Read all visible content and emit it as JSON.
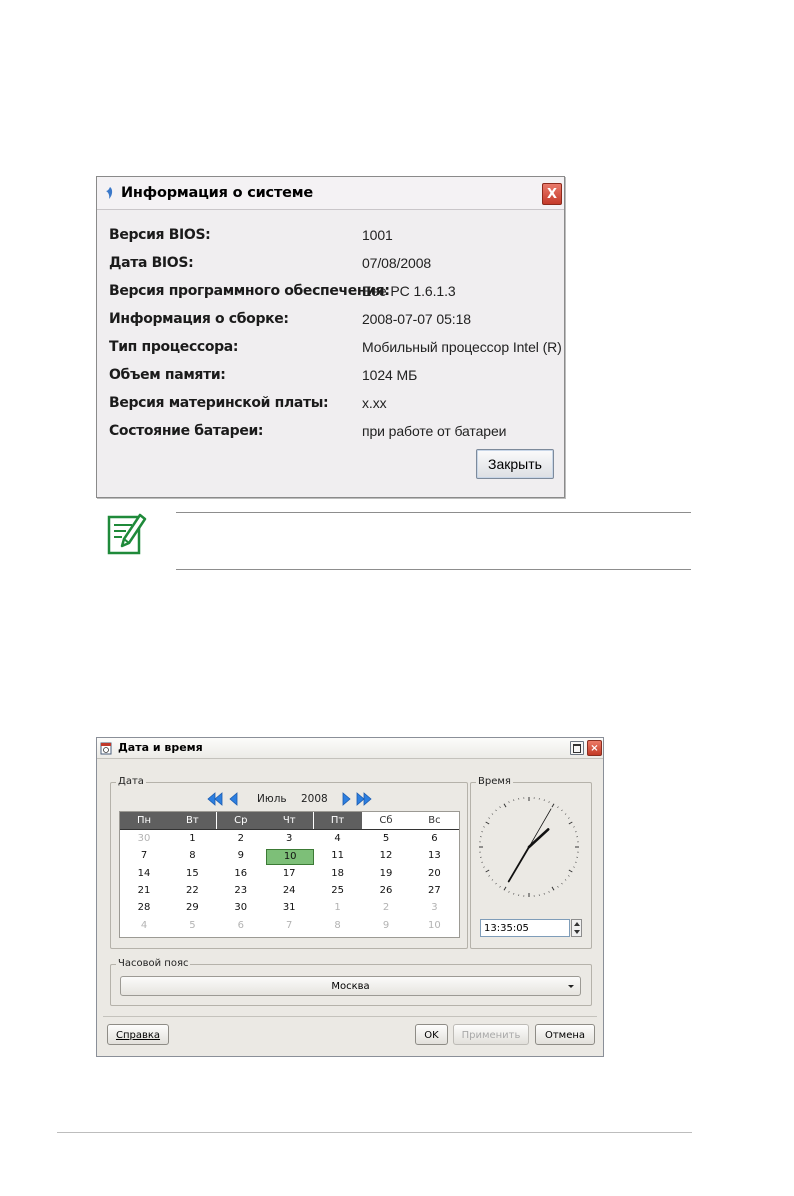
{
  "sysinfo": {
    "title": "Информация о системе",
    "close_glyph": "X",
    "rows": [
      {
        "label": "Версия BIOS:",
        "value": "1001"
      },
      {
        "label": "Дата BIOS:",
        "value": "07/08/2008"
      },
      {
        "label": "Версия программного обеспечения:",
        "value": "Eee PC 1.6.1.3"
      },
      {
        "label": "Информация о сборке:",
        "value": "2008-07-07 05:18"
      },
      {
        "label": "Тип процессора:",
        "value": "Мобильный процессор Intel (R)"
      },
      {
        "label": "Объем памяти:",
        "value": "1024 МБ"
      },
      {
        "label": "Версия материнской платы:",
        "value": "x.xx"
      },
      {
        "label": "Состояние батареи:",
        "value": "при работе от батареи"
      }
    ],
    "close_button": "Закрыть"
  },
  "note": {
    "icon": "note-pencil-icon"
  },
  "datetime": {
    "title": "Дата и время",
    "date_group": "Дата",
    "month": "Июль",
    "year": "2008",
    "weekdays": [
      "Пн",
      "Вт",
      "Ср",
      "Чт",
      "Пт",
      "Сб",
      "Вс"
    ],
    "weeks": [
      [
        "30",
        "1",
        "2",
        "3",
        "4",
        "5",
        "6"
      ],
      [
        "7",
        "8",
        "9",
        "10",
        "11",
        "12",
        "13"
      ],
      [
        "14",
        "15",
        "16",
        "17",
        "18",
        "19",
        "20"
      ],
      [
        "21",
        "22",
        "23",
        "24",
        "25",
        "26",
        "27"
      ],
      [
        "28",
        "29",
        "30",
        "31",
        "1",
        "2",
        "3"
      ],
      [
        "4",
        "5",
        "6",
        "7",
        "8",
        "9",
        "10"
      ]
    ],
    "selected_day": "10",
    "time_group": "Время",
    "time": "13:35:05",
    "timezone_group": "Часовой пояс",
    "timezone": "Москва",
    "buttons": {
      "help": "Справка",
      "ok": "OK",
      "apply": "Применить",
      "cancel": "Отмена"
    },
    "accent_selected": "#7dbf78"
  }
}
